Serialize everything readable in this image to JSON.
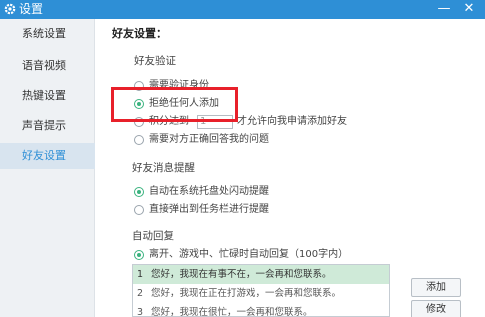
{
  "window": {
    "title": "设置",
    "minimize_glyph": "—",
    "close_glyph": "✕"
  },
  "sidebar": {
    "items": [
      {
        "label": "系统设置"
      },
      {
        "label": "语音视频"
      },
      {
        "label": "热键设置"
      },
      {
        "label": "声音提示"
      },
      {
        "label": "好友设置",
        "active": true
      }
    ]
  },
  "main": {
    "title": "好友设置：",
    "verification": {
      "title": "好友验证",
      "options": [
        {
          "label": "需要验证身份",
          "selected": false
        },
        {
          "label": "拒绝任何人添加",
          "selected": true
        },
        {
          "label": "积分达到",
          "suffix": "才允许向我申请添加好友",
          "selected": false
        },
        {
          "label": "需要对方正确回答我的问题",
          "selected": false
        }
      ],
      "score_value": "1"
    },
    "message_alert": {
      "title": "好友消息提醒",
      "options": [
        {
          "label": "自动在系统托盘处闪动提醒",
          "selected": true
        },
        {
          "label": "直接弹出到任务栏进行提醒",
          "selected": false
        }
      ]
    },
    "auto_reply": {
      "title": "自动回复",
      "option": {
        "label": "离开、游戏中、忙碌时自动回复（100字内）",
        "selected": true
      },
      "replies": [
        {
          "num": "1",
          "text": "您好，我现在有事不在，一会再和您联系。"
        },
        {
          "num": "2",
          "text": "您好，我现在正在打游戏，一会再和您联系。"
        },
        {
          "num": "3",
          "text": "您好，我现在很忙，一会再和您联系。"
        }
      ],
      "add_label": "添加",
      "edit_label": "修改"
    }
  },
  "colors": {
    "titlebar": "#2e8fd6",
    "accent_green": "#3bb37f",
    "highlight_red": "#e8202a",
    "selected_row": "#cfead8"
  }
}
